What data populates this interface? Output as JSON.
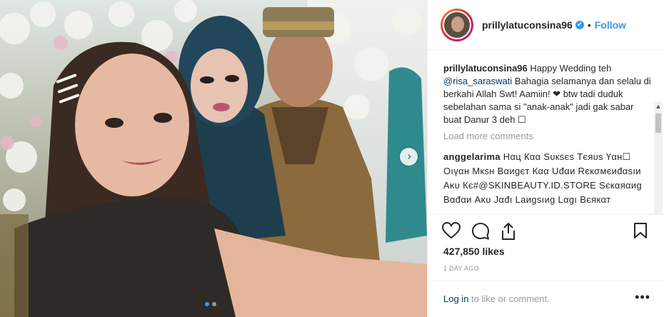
{
  "post": {
    "photo_dots": [
      {
        "active": true
      },
      {
        "active": false
      }
    ],
    "next_arrow": "›"
  },
  "header": {
    "username": "prillylatuconsina96",
    "verified_glyph": "✔",
    "separator": "•",
    "follow_label": "Follow"
  },
  "caption": {
    "username": "prillylatuconsina96",
    "text_before": " Happy Wedding teh ",
    "mention": "@risa_saraswati",
    "text_after": " Bahagia selamanya dan selalu di berkahi Allah Swt! Aamiin! ❤ btw tadi duduk sebelahan sama si \"anak-anak\" jadi gak sabar buat Danur 3 deh ☐"
  },
  "load_more_label": "Load more comments",
  "comment": {
    "username": "anggelarima",
    "text": " Нαц Кαα Sυкѕєѕ Тєяυѕ Үαн☐ Оıүαн Мкѕн Вαиgєт Кαα Uđαи Rєкσмєиđαѕıи Аκυ Кє#@SKINBEAUTY.ID.STORE Ѕєкαяαиg Вαđαи Аκυ Јαđı Laиgѕıиg Lαgı Вєякαт"
  },
  "likes_label": "427,850 likes",
  "time_label": "1 DAY AGO",
  "login": {
    "link": "Log in",
    "text": " to like or comment.",
    "more_glyph": "•••"
  },
  "colors": {
    "accent": "#3897f0",
    "mention": "#003569",
    "muted": "#999999"
  }
}
